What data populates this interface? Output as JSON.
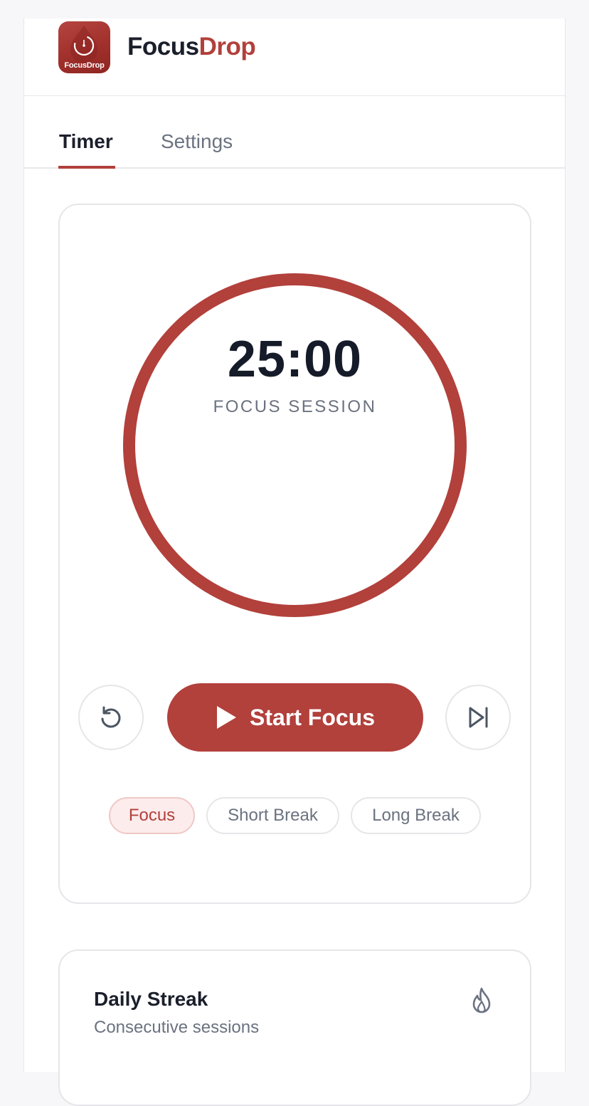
{
  "app": {
    "brand_part1": "Focus",
    "brand_part2": "Drop",
    "logo_text": "FocusDrop"
  },
  "tabs": [
    {
      "label": "Timer",
      "active": true
    },
    {
      "label": "Settings",
      "active": false
    }
  ],
  "timer": {
    "time": "25:00",
    "session_label": "FOCUS SESSION",
    "progress": 1.0,
    "reset_icon": "reset-icon",
    "skip_icon": "skip-icon",
    "start_label": "Start Focus",
    "start_icon": "play-icon"
  },
  "modes": [
    {
      "label": "Focus",
      "selected": true
    },
    {
      "label": "Short Break",
      "selected": false
    },
    {
      "label": "Long Break",
      "selected": false
    }
  ],
  "streak": {
    "title": "Daily Streak",
    "subtitle": "Consecutive sessions",
    "icon": "flame-icon"
  },
  "colors": {
    "accent": "#b2403b",
    "accent_soft": "#fcecec",
    "text_dark": "#1b1f2b",
    "text_muted": "#6b7280",
    "border": "#e6e6ea"
  }
}
